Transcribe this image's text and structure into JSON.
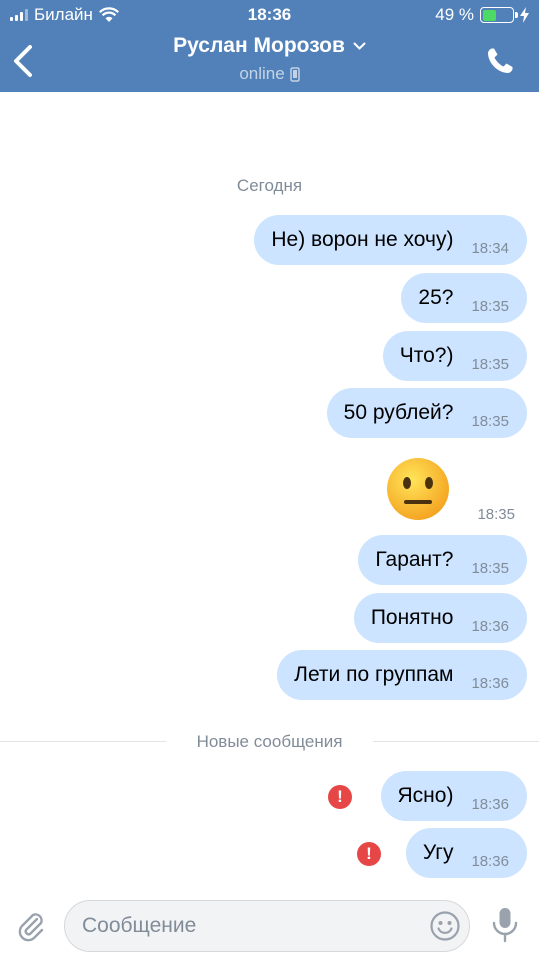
{
  "status_bar": {
    "carrier": "Билайн",
    "time": "18:36",
    "battery": "49 %",
    "battery_level": 0.49
  },
  "header": {
    "contact_name": "Руслан Морозов",
    "status": "online"
  },
  "chat": {
    "date_label": "Сегодня",
    "messages": [
      {
        "text": "Не) ворон не хочу)",
        "time": "18:34"
      },
      {
        "text": "25?",
        "time": "18:35"
      },
      {
        "text": "Что?)",
        "time": "18:35"
      },
      {
        "text": "50 рублей?",
        "time": "18:35"
      },
      {
        "sticker": "neutral-face-emoji",
        "time": "18:35"
      },
      {
        "text": "Гарант?",
        "time": "18:35"
      },
      {
        "text": "Понятно",
        "time": "18:36"
      },
      {
        "text": "Лети по группам",
        "time": "18:36"
      }
    ],
    "new_messages_label": "Новые сообщения",
    "failed_messages": [
      {
        "text": "Ясно)",
        "time": "18:36",
        "status_icon": "error-icon"
      },
      {
        "text": "Угу",
        "time": "18:36",
        "status_icon": "error-icon"
      }
    ]
  },
  "composer": {
    "placeholder": "Сообщение"
  },
  "colors": {
    "header": "#5181b8",
    "bubble": "#cce4ff",
    "error": "#e64646",
    "muted": "#818c99"
  }
}
